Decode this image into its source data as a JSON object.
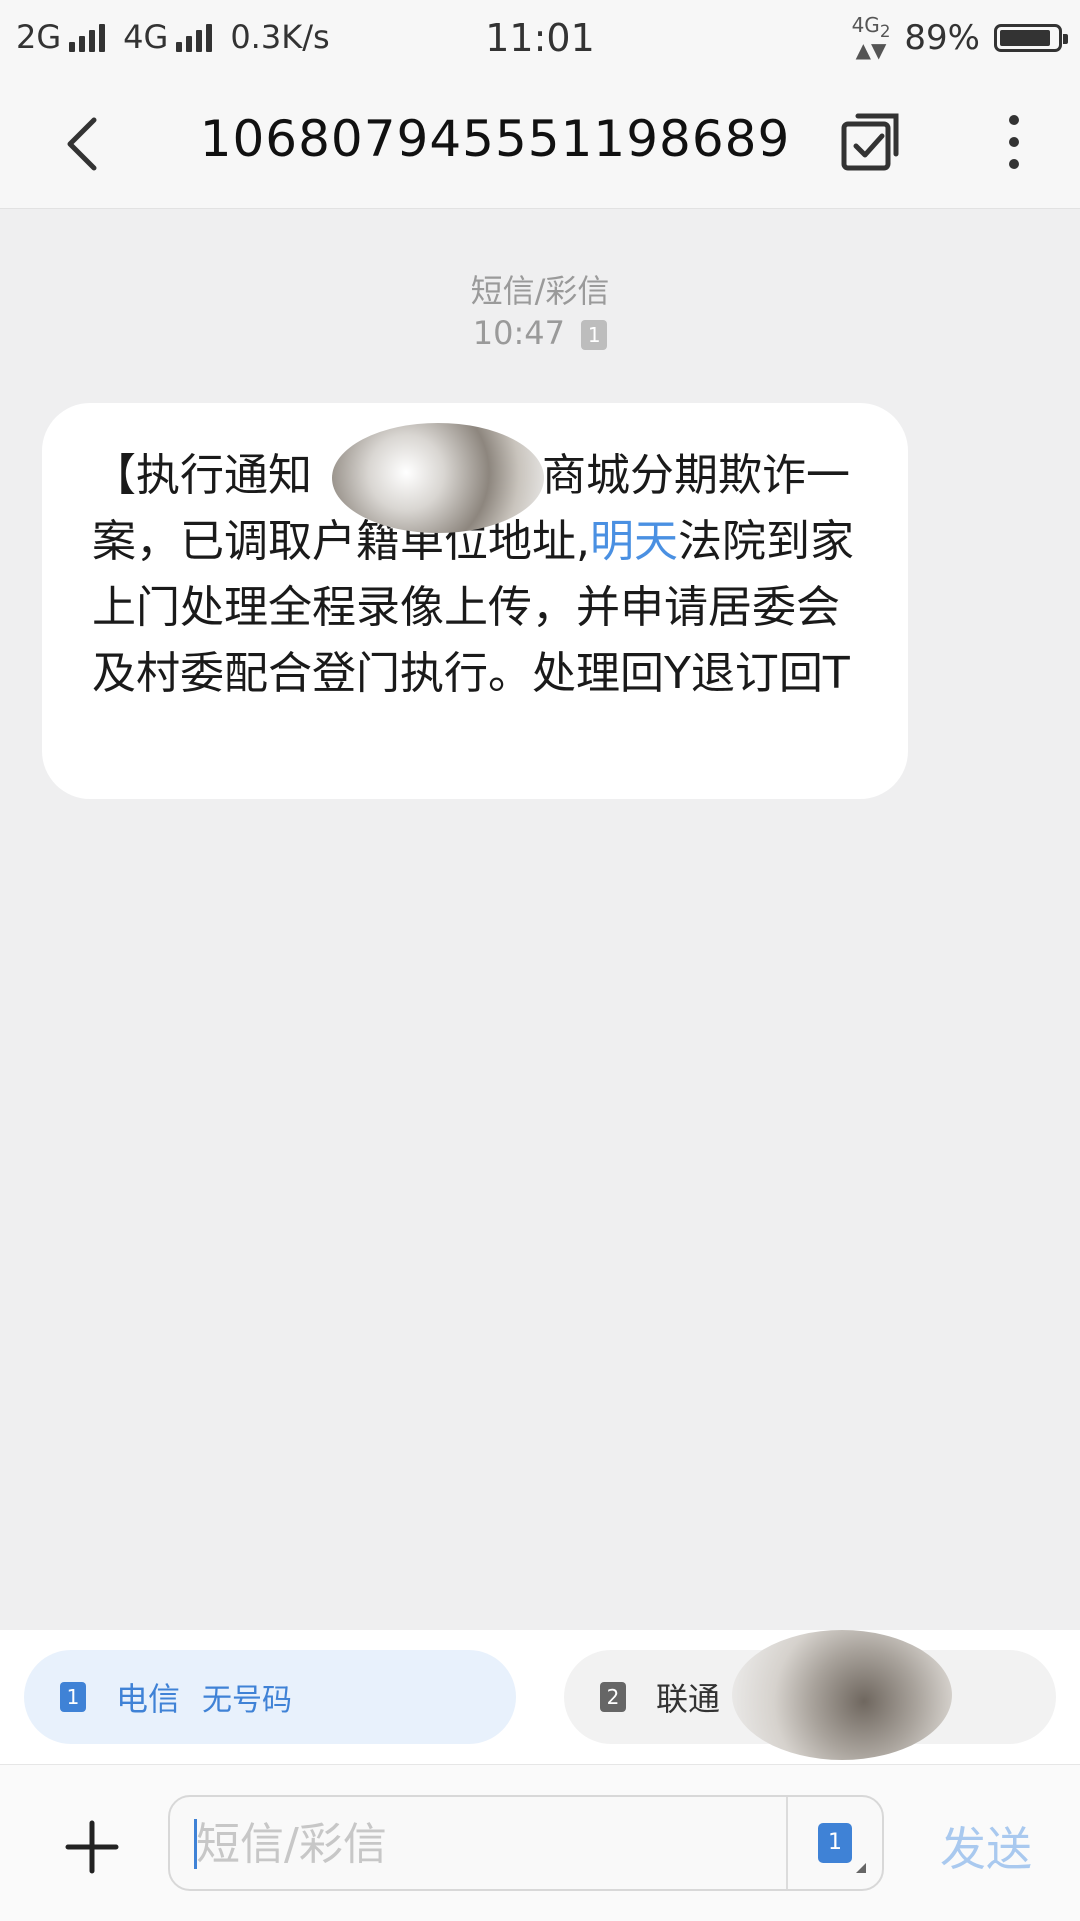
{
  "status": {
    "net1": "2G",
    "net2": "4G",
    "speed": "0.3K/s",
    "time": "11:01",
    "net_indicator_top": "4G",
    "net_indicator_sub": "2",
    "battery": "89%",
    "battery_level": 0.89
  },
  "header": {
    "title": "106807945551198689",
    "back_icon": "chevron-left",
    "edit_icon": "edit-square",
    "more_icon": "more-vertical"
  },
  "message": {
    "type_label": "短信/彩信",
    "time": "10:47",
    "sim_index": "1",
    "text_before_blur": "【执行通知",
    "text_after_blur": "商城分期欺诈一案，已调取户籍单位地址,",
    "link_text": "明天",
    "text_after_link": "法院到家上门处理全程录像上传，并申请居委会及村委配合登门执行。处理回Y退订回T"
  },
  "sims": [
    {
      "index": "1",
      "carrier": "电信",
      "number": "无号码"
    },
    {
      "index": "2",
      "carrier": "联通",
      "number": ""
    }
  ],
  "composer": {
    "placeholder": "短信/彩信",
    "sim_index": "1",
    "send_label": "发送"
  },
  "colors": {
    "accent": "#3f82d6",
    "link": "#4a90e2",
    "send_disabled": "#a9c9ef"
  }
}
